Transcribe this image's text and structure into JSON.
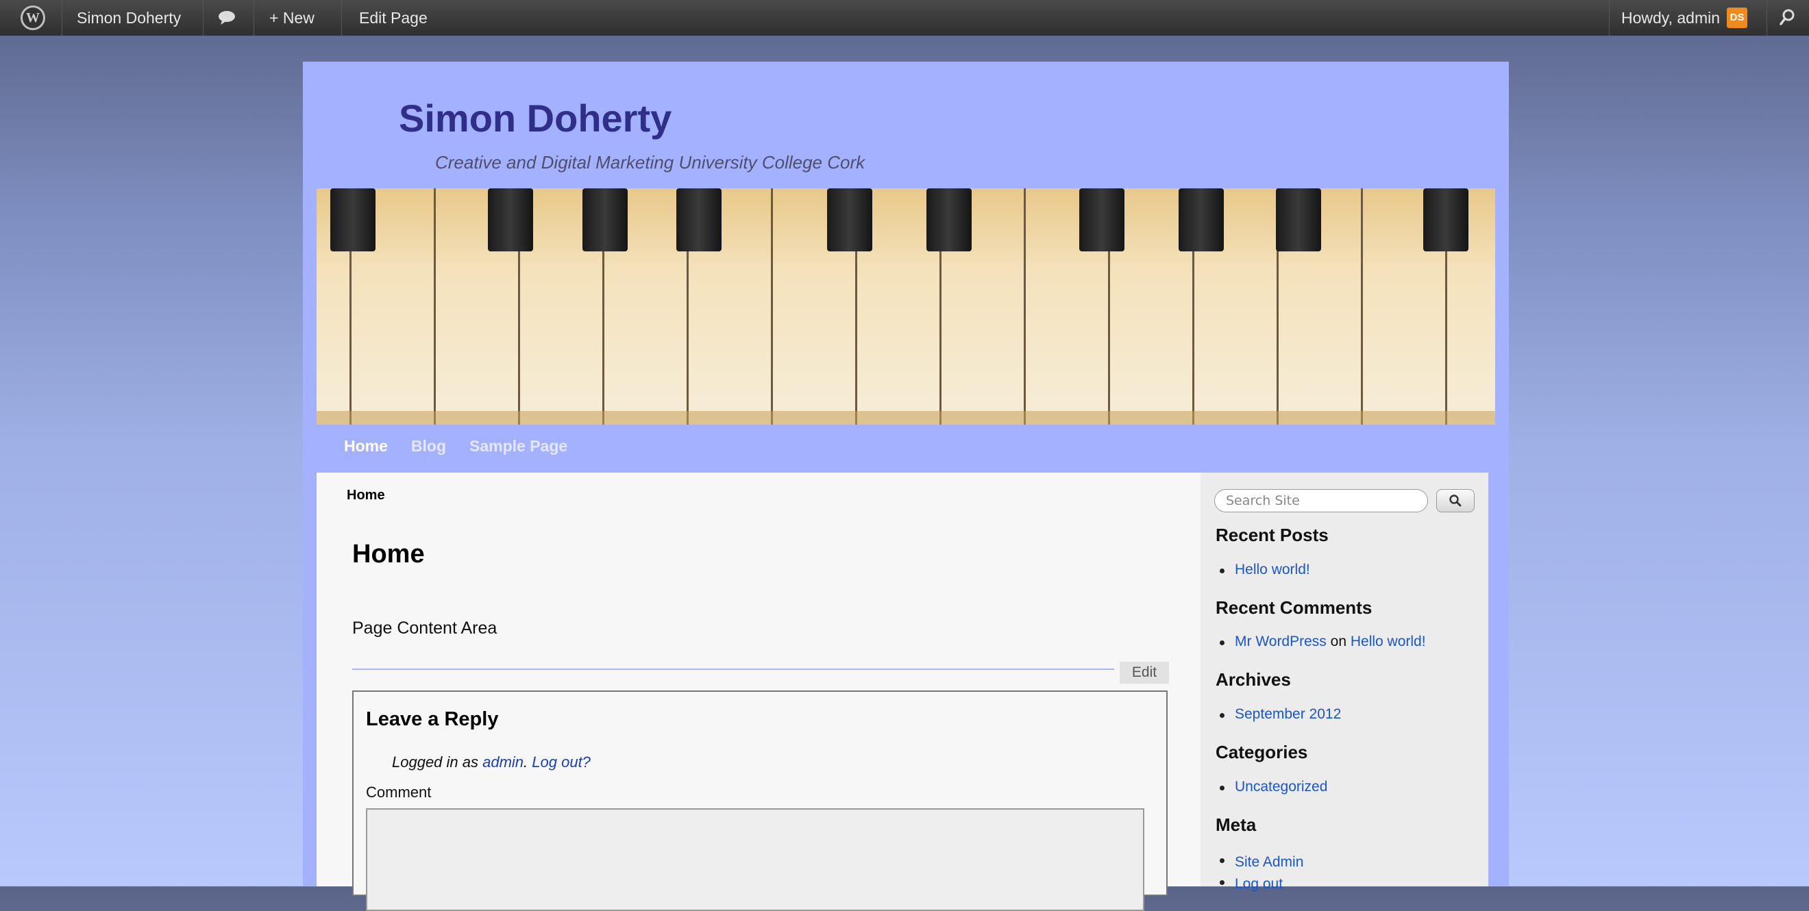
{
  "admin_bar": {
    "site_name": "Simon Doherty",
    "new_label": "+ New",
    "edit_page_label": "Edit Page",
    "howdy": "Howdy, admin",
    "avatar_text": "DS"
  },
  "header": {
    "title": "Simon Doherty",
    "description": "Creative and Digital Marketing University College Cork"
  },
  "nav": {
    "items": [
      "Home",
      "Blog",
      "Sample Page"
    ]
  },
  "content": {
    "breadcrumb": "Home",
    "title": "Home",
    "body": "Page Content Area",
    "edit_label": "Edit",
    "reply": {
      "title": "Leave a Reply",
      "logged_prefix": "Logged in as",
      "user": "admin",
      "logout": "Log out?",
      "comment_label": "Comment"
    }
  },
  "sidebar": {
    "search_placeholder": "Search Site",
    "recent_posts": {
      "title": "Recent Posts",
      "items": [
        "Hello world!"
      ]
    },
    "recent_comments": {
      "title": "Recent Comments",
      "author": "Mr WordPress",
      "on": "on",
      "post": "Hello world!"
    },
    "archives": {
      "title": "Archives",
      "items": [
        "September 2012"
      ]
    },
    "categories": {
      "title": "Categories",
      "items": [
        "Uncategorized"
      ]
    },
    "meta": {
      "title": "Meta",
      "items": [
        "Site Admin",
        "Log out"
      ]
    }
  },
  "colors": {
    "wrapper_bg": "#a3b1ff",
    "site_title": "#2f2f8a",
    "link": "#1a55c9",
    "admin_bar": "#333333"
  }
}
